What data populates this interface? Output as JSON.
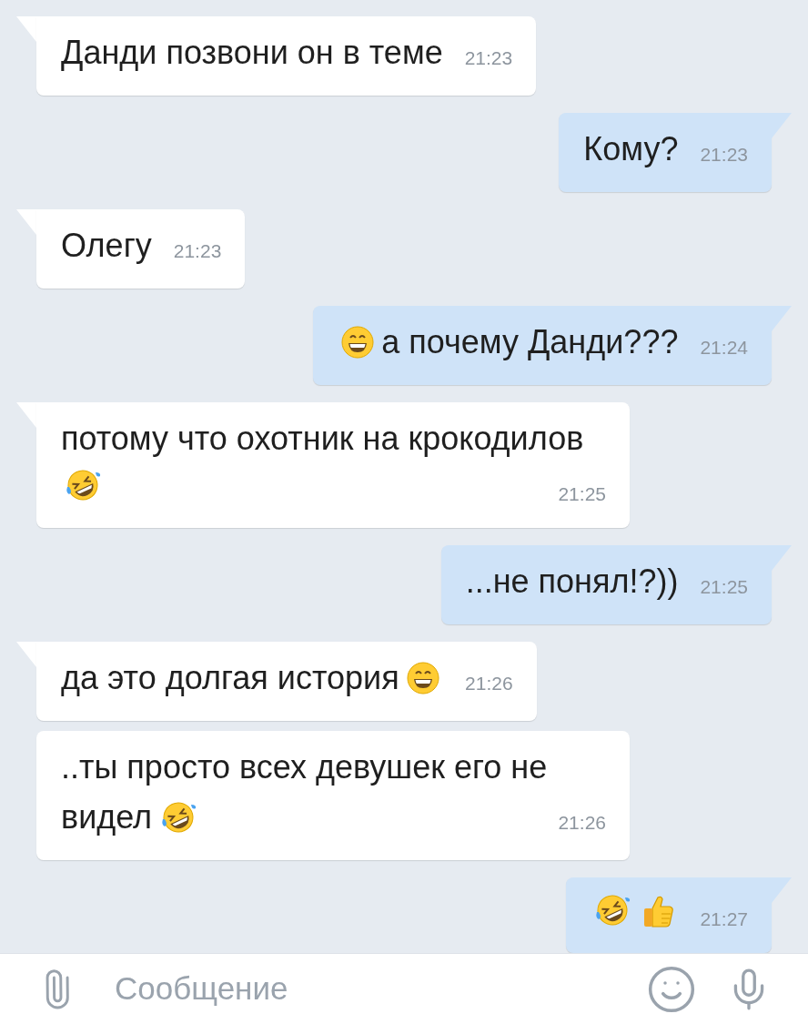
{
  "messages": [
    {
      "outgoing": false,
      "tail": true,
      "parts": [
        {
          "kind": "text",
          "text": "Данди позвони он в теме"
        }
      ],
      "time": "21:23"
    },
    {
      "outgoing": true,
      "tail": true,
      "parts": [
        {
          "kind": "text",
          "text": "Кому?"
        }
      ],
      "time": "21:23"
    },
    {
      "outgoing": false,
      "tail": true,
      "parts": [
        {
          "kind": "text",
          "text": "Олегу"
        }
      ],
      "time": "21:23"
    },
    {
      "outgoing": true,
      "tail": true,
      "parts": [
        {
          "kind": "grin"
        },
        {
          "kind": "text",
          "text": "а почему Данди???"
        }
      ],
      "time": "21:24"
    },
    {
      "outgoing": false,
      "tail": true,
      "parts": [
        {
          "kind": "text",
          "text": "потому что охотник на крокодилов"
        },
        {
          "kind": "rofl"
        }
      ],
      "time": "21:25"
    },
    {
      "outgoing": true,
      "tail": true,
      "parts": [
        {
          "kind": "text",
          "text": "...не понял!?))"
        }
      ],
      "time": "21:25"
    },
    {
      "outgoing": false,
      "tail": true,
      "parts": [
        {
          "kind": "text",
          "text": "да это долгая история"
        },
        {
          "kind": "grin"
        }
      ],
      "time": "21:26"
    },
    {
      "outgoing": false,
      "tail": false,
      "parts": [
        {
          "kind": "text",
          "text": "..ты просто всех девушек его не"
        },
        {
          "kind": "text",
          "text": "видел"
        },
        {
          "kind": "rofl"
        }
      ],
      "time": "21:26"
    },
    {
      "outgoing": true,
      "tail": true,
      "parts": [
        {
          "kind": "rofl"
        },
        {
          "kind": "thumbs-up"
        }
      ],
      "time": "21:27"
    }
  ],
  "composer": {
    "placeholder": "Сообщение"
  }
}
